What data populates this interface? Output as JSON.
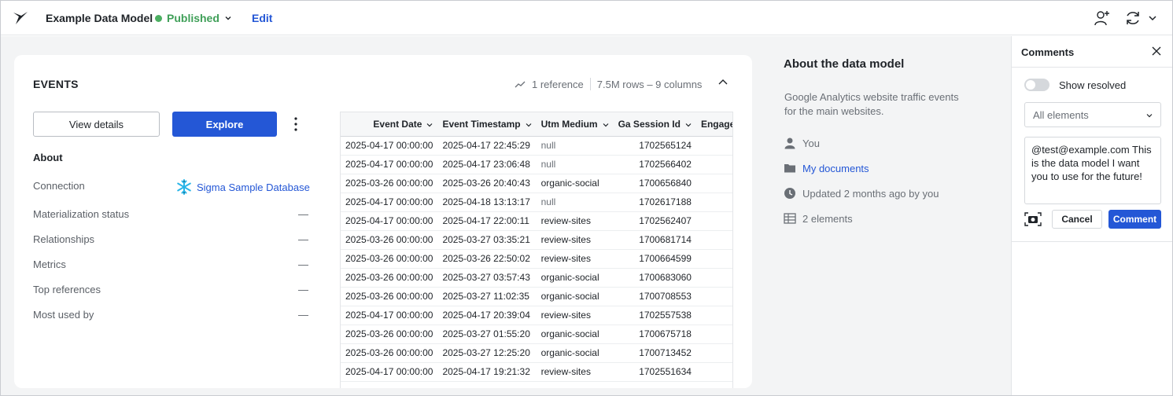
{
  "header": {
    "logo_icon": "sigma-logo-icon",
    "title": "Example Data Model",
    "status": "Published",
    "status_color": "#4caf62",
    "edit_label": "Edit",
    "right_icons": [
      "add-user-icon",
      "sync-icon",
      "chevron-down-icon"
    ]
  },
  "element": {
    "title": "EVENTS",
    "references": "1 reference",
    "size": "7.5M rows – 9 columns",
    "view_details_label": "View details",
    "explore_label": "Explore",
    "about_heading": "About",
    "properties": [
      {
        "label": "Connection",
        "value": ""
      },
      {
        "label": "Materialization status",
        "value": "—"
      },
      {
        "label": "Relationships",
        "value": "—"
      },
      {
        "label": "Metrics",
        "value": "—"
      },
      {
        "label": "Top references",
        "value": "—"
      },
      {
        "label": "Most used by",
        "value": "—"
      }
    ],
    "connection_name": "Sigma Sample Database",
    "accent_color": "#2457d6"
  },
  "table": {
    "columns": [
      "Event Date",
      "Event Timestamp",
      "Utm Medium",
      "Ga Session Id",
      "Engage"
    ],
    "rows": [
      [
        "2025-04-17 00:00:00",
        "2025-04-17 22:45:29",
        "null",
        "1702565124",
        ""
      ],
      [
        "2025-04-17 00:00:00",
        "2025-04-17 23:06:48",
        "null",
        "1702566402",
        ""
      ],
      [
        "2025-03-26 00:00:00",
        "2025-03-26 20:40:43",
        "organic-social",
        "1700656840",
        ""
      ],
      [
        "2025-04-17 00:00:00",
        "2025-04-18 13:13:17",
        "null",
        "1702617188",
        ""
      ],
      [
        "2025-04-17 00:00:00",
        "2025-04-17 22:00:11",
        "review-sites",
        "1702562407",
        ""
      ],
      [
        "2025-03-26 00:00:00",
        "2025-03-27 03:35:21",
        "review-sites",
        "1700681714",
        ""
      ],
      [
        "2025-03-26 00:00:00",
        "2025-03-26 22:50:02",
        "review-sites",
        "1700664599",
        ""
      ],
      [
        "2025-03-26 00:00:00",
        "2025-03-27 03:57:43",
        "organic-social",
        "1700683060",
        ""
      ],
      [
        "2025-03-26 00:00:00",
        "2025-03-27 11:02:35",
        "organic-social",
        "1700708553",
        ""
      ],
      [
        "2025-04-17 00:00:00",
        "2025-04-17 20:39:04",
        "review-sites",
        "1702557538",
        ""
      ],
      [
        "2025-03-26 00:00:00",
        "2025-03-27 01:55:20",
        "organic-social",
        "1700675718",
        ""
      ],
      [
        "2025-03-26 00:00:00",
        "2025-03-27 12:25:20",
        "organic-social",
        "1700713452",
        ""
      ],
      [
        "2025-04-17 00:00:00",
        "2025-04-17 19:21:32",
        "review-sites",
        "1702551634",
        ""
      ]
    ]
  },
  "about": {
    "title": "About the data model",
    "description": "Google Analytics website traffic events for the main websites.",
    "owner": "You",
    "folder": "My documents",
    "updated": "Updated 2 months ago by you",
    "elements": "2 elements"
  },
  "comments": {
    "title": "Comments",
    "show_resolved_label": "Show resolved",
    "filter_value": "All elements",
    "draft": "@test@example.com This is the data model I want you to use for the future!",
    "cancel_label": "Cancel",
    "comment_label": "Comment"
  }
}
